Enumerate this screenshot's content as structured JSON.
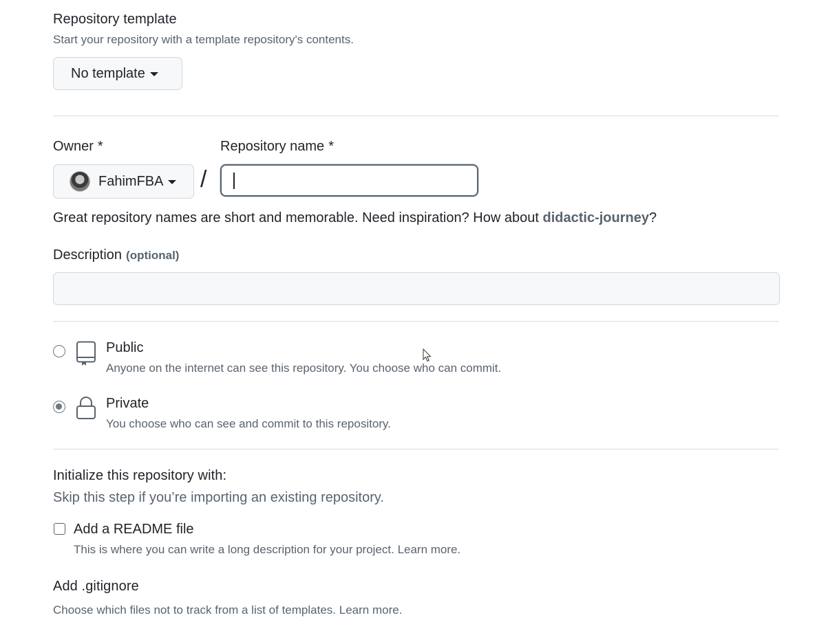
{
  "template_section": {
    "title": "Repository template",
    "subtitle": "Start your repository with a template repository's contents.",
    "dropdown_label": "No template"
  },
  "owner": {
    "label": "Owner",
    "required_mark": "*",
    "username": "FahimFBA"
  },
  "separator": "/",
  "repo_name": {
    "label": "Repository name",
    "required_mark": "*",
    "value": ""
  },
  "name_hint": {
    "text_before": "Great repository names are short and memorable. Need inspiration? How about ",
    "suggestion": "didactic-journey",
    "text_after": "?"
  },
  "description": {
    "label": "Description",
    "optional": "(optional)",
    "value": ""
  },
  "visibility": {
    "options": [
      {
        "title": "Public",
        "description": "Anyone on the internet can see this repository. You choose who can commit.",
        "selected": false,
        "icon": "repo-icon"
      },
      {
        "title": "Private",
        "description": "You choose who can see and commit to this repository.",
        "selected": true,
        "icon": "lock-icon"
      }
    ]
  },
  "initialize": {
    "title": "Initialize this repository with:",
    "subtitle": "Skip this step if you’re importing an existing repository.",
    "readme_label": "Add a README file",
    "readme_description": "This is where you can write a long description for your project.",
    "readme_link": "Learn more.",
    "readme_checked": false
  },
  "gitignore": {
    "title": "Add .gitignore",
    "description": "Choose which files not to track from a list of templates.",
    "link": "Learn more."
  },
  "colors": {
    "text": "#1f2328",
    "muted": "#59636e",
    "border": "#d0d7de",
    "input_bg": "#f6f8fa"
  }
}
